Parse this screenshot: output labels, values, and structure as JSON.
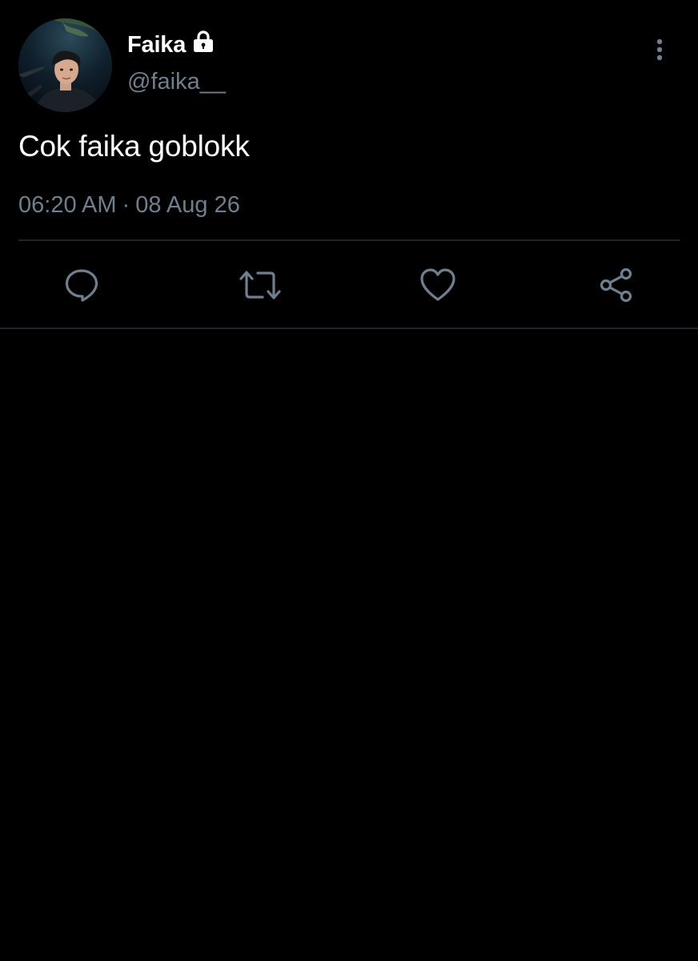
{
  "tweet": {
    "display_name": "Faika",
    "handle": "@faika__",
    "protected_icon": "lock-icon",
    "text": "Cok faika goblokk",
    "time": "06:20 AM",
    "separator": "·",
    "date": "08 Aug 26"
  },
  "actions": [
    {
      "name": "reply",
      "icon": "reply-icon"
    },
    {
      "name": "retweet",
      "icon": "retweet-icon"
    },
    {
      "name": "like",
      "icon": "heart-icon"
    },
    {
      "name": "share",
      "icon": "share-icon"
    }
  ],
  "menu": {
    "icon": "more-vertical-icon"
  },
  "colors": {
    "background": "#000000",
    "primary_text": "#ffffff",
    "secondary_text": "#6e7f8e",
    "divider": "#1f2428",
    "icon": "#6e7f8e"
  }
}
